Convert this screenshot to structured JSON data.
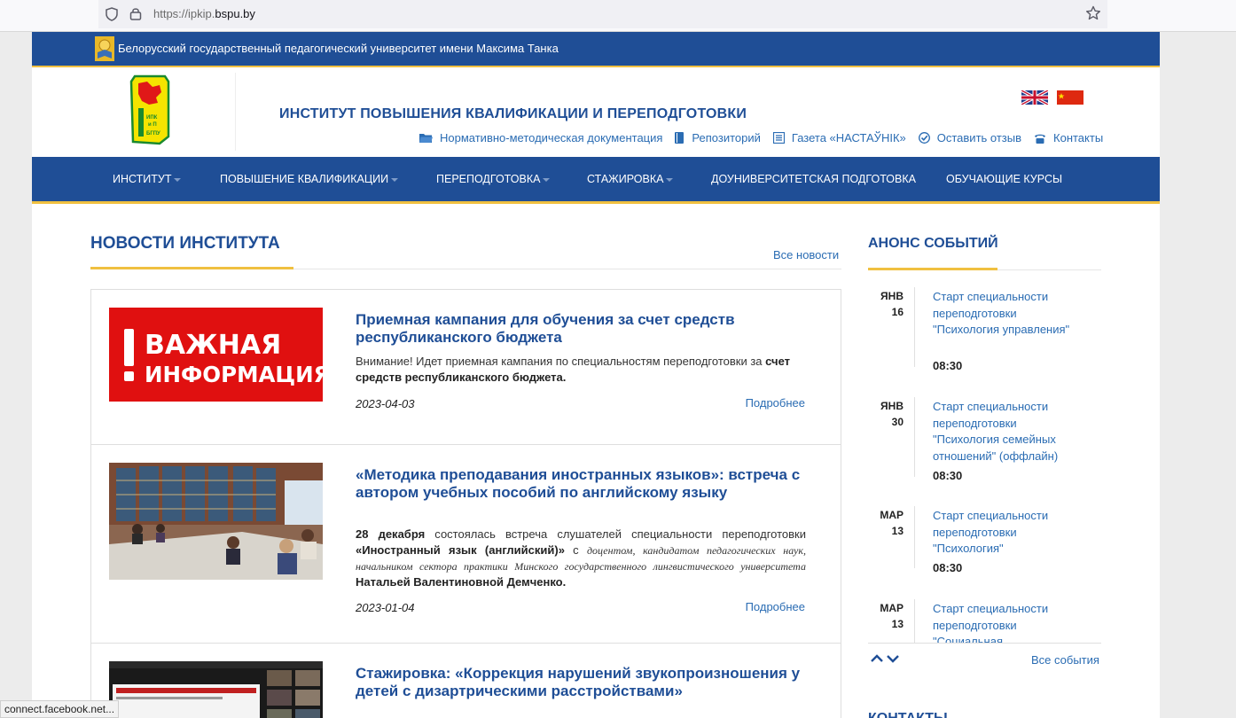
{
  "browser": {
    "url_prefix": "https://ipkip.",
    "url_domain": "bspu.by"
  },
  "topbar": {
    "university_name": "Белорусский государственный педагогический университет имени Максима Танка"
  },
  "header": {
    "institute_title": "ИНСТИТУТ ПОВЫШЕНИЯ КВАЛИФИКАЦИИ И ПЕРЕПОДГОТОВКИ",
    "logo_text": "ИПК и П БГПУ",
    "links": [
      {
        "label": "Нормативно-методическая документация",
        "icon": "folder-icon"
      },
      {
        "label": "Репозиторий",
        "icon": "book-icon"
      },
      {
        "label": "Газета «НАСТАЎНІК»",
        "icon": "newspaper-icon"
      },
      {
        "label": "Оставить отзыв",
        "icon": "check-square-icon"
      },
      {
        "label": "Контакты",
        "icon": "phone-icon"
      }
    ]
  },
  "nav": {
    "items": [
      {
        "label": "ИНСТИТУТ",
        "dropdown": true
      },
      {
        "label": "ПОВЫШЕНИЕ КВАЛИФИКАЦИИ",
        "dropdown": true
      },
      {
        "label": "ПЕРЕПОДГОТОВКА",
        "dropdown": true
      },
      {
        "label": "СТАЖИРОВКА",
        "dropdown": true
      },
      {
        "label": "ДОУНИВЕРСИТЕТСКАЯ ПОДГОТОВКА",
        "dropdown": false
      },
      {
        "label": "ОБУЧАЮЩИЕ КУРСЫ",
        "dropdown": false
      }
    ]
  },
  "news": {
    "heading": "НОВОСТИ ИНСТИТУТА",
    "all_link": "Все новости",
    "more_label": "Подробнее",
    "items": [
      {
        "title": "Приемная кампания для обучения за счет средств республиканского бюджета",
        "image_caption_1": "ВАЖНАЯ",
        "image_caption_2": "ИНФОРМАЦИЯ",
        "text_1": "Внимание! Идет приемная кампания по специальностям переподготовки за ",
        "text_bold": "счет средств республиканского бюджета.",
        "date": "2023-04-03"
      },
      {
        "title": "«Методика преподавания иностранных языков»: встреча с автором учебных пособий по английскому языку",
        "text_b1": "28 декабря",
        "text_1": " состоялась встреча слушателей специальности переподготовки ",
        "text_b2": "«Иностранный язык (английский)»",
        "text_2": " с ",
        "text_i": "доцентом, кандидатом педагогических наук, начальником сектора практики Минского государственного лингвистического университета",
        "text_b3": " Натальей Валентиновной Демченко.",
        "date": "2023-01-04"
      },
      {
        "title": "Стажировка: «Коррекция нарушений звукопроизношения у детей с дизартрическими расстройствами»"
      }
    ]
  },
  "events": {
    "heading": "АНОНС СОБЫТИЙ",
    "all_link": "Все события",
    "items": [
      {
        "month": "ЯНВ",
        "day": "16",
        "title": "Старт специальности переподготовки \"Психология управления\"",
        "time": "08:30"
      },
      {
        "month": "ЯНВ",
        "day": "30",
        "title": "Старт специальности переподготовки \"Психология семейных отношений\" (оффлайн)",
        "time": "08:30"
      },
      {
        "month": "МАР",
        "day": "13",
        "title": "Старт специальности переподготовки \"Психология\"",
        "time": "08:30"
      },
      {
        "month": "МАР",
        "day": "13",
        "title": "Старт специальности переподготовки \"Социальная",
        "time": ""
      }
    ]
  },
  "contacts_heading_peek": "КОНТАКТЫ",
  "status_bar": "connect.facebook.net...",
  "colors": {
    "brand_blue": "#1f4e96",
    "accent_yellow": "#f0c040",
    "link_blue": "#2a6cb3"
  }
}
